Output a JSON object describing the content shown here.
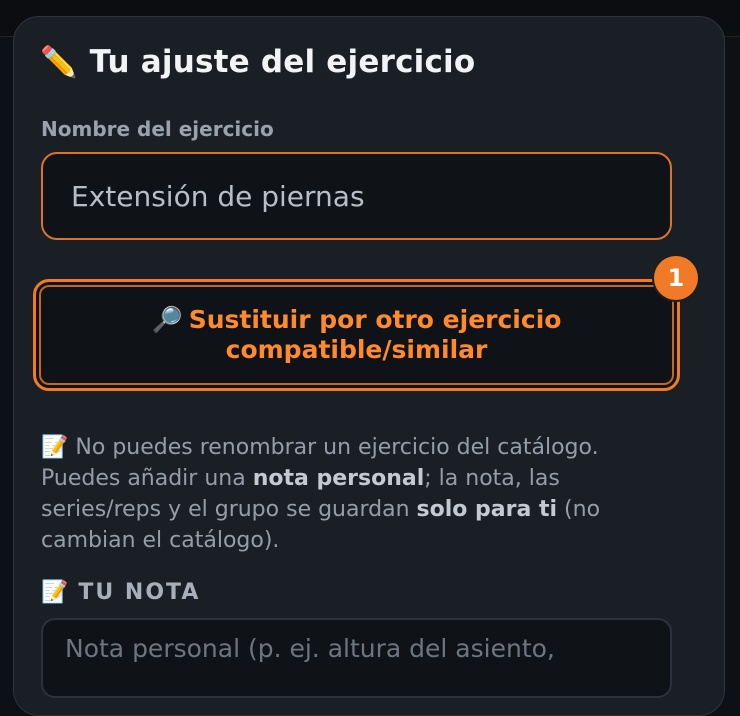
{
  "panel": {
    "title_emoji": "✏️",
    "title": "Tu ajuste del ejercicio",
    "name_label": "Nombre del ejercicio",
    "name_value": "Extensión de piernas",
    "substitute_button": {
      "emoji": "🔎",
      "line1": "Sustituir por otro ejercicio",
      "line2": "compatible/similar",
      "badge": "1"
    },
    "info": {
      "emoji": "📝",
      "text1": "No puedes renombrar un ejercicio del catálogo. Puedes añadir una ",
      "bold1": "nota personal",
      "text2": "; la nota, las series/reps y el grupo se guardan ",
      "bold2": "solo para ti",
      "text3": " (no cambian el catálogo)."
    },
    "note_section": {
      "emoji": "📝",
      "heading": "TU NOTA",
      "placeholder": "Nota personal (p. ej. altura del asiento,"
    }
  },
  "colors": {
    "accent": "#f07a26",
    "panel_bg": "#1a1f26",
    "input_bg": "#0f1318"
  }
}
